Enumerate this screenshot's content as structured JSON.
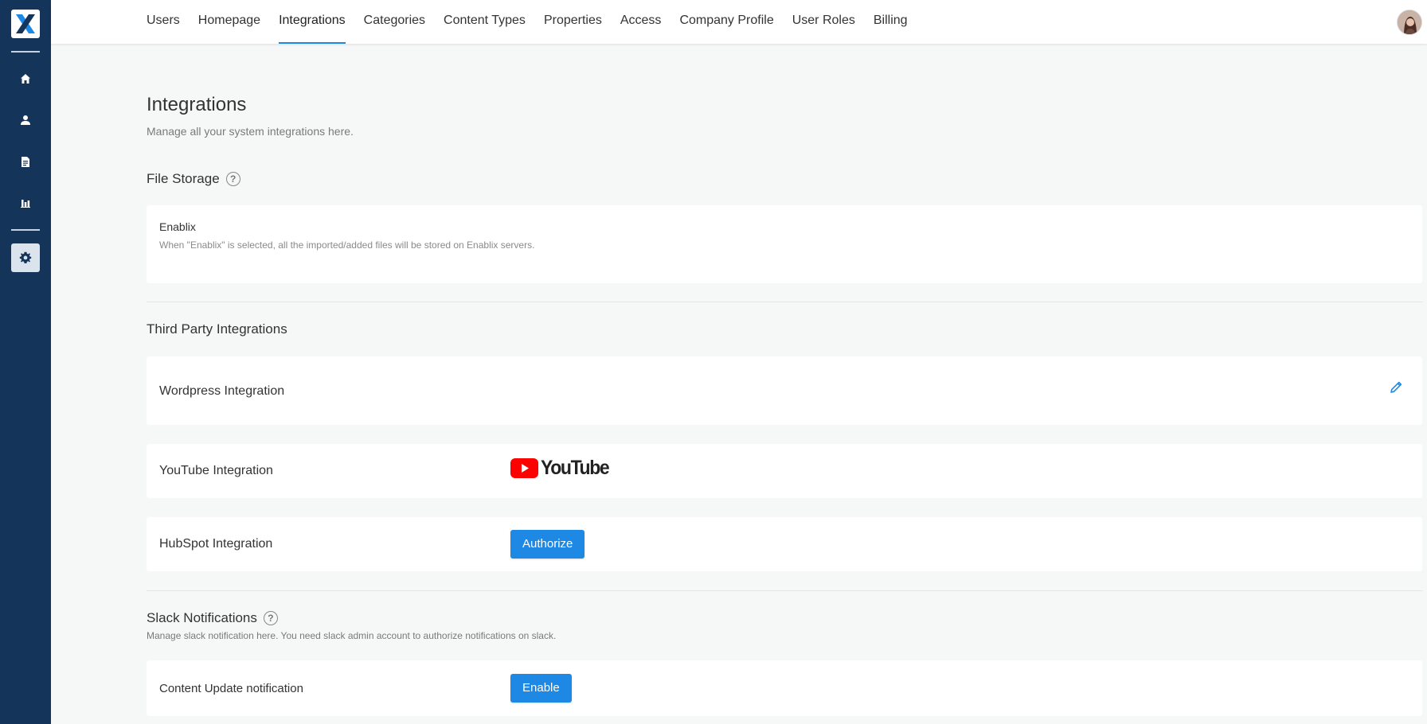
{
  "nav": {
    "tabs": [
      {
        "label": "Users"
      },
      {
        "label": "Homepage"
      },
      {
        "label": "Integrations",
        "active": true
      },
      {
        "label": "Categories"
      },
      {
        "label": "Content Types"
      },
      {
        "label": "Properties"
      },
      {
        "label": "Access"
      },
      {
        "label": "Company Profile"
      },
      {
        "label": "User Roles"
      },
      {
        "label": "Billing"
      }
    ]
  },
  "sidebar": {
    "icons": [
      "home-icon",
      "user-icon",
      "document-icon",
      "bar-chart-icon",
      "gear-icon"
    ],
    "active": "gear-icon"
  },
  "page": {
    "title": "Integrations",
    "subtitle": "Manage all your system integrations here."
  },
  "file_storage": {
    "title": "File Storage",
    "option_name": "Enablix",
    "option_desc": "When \"Enablix\" is selected, all the imported/added files will be stored on Enablix servers."
  },
  "third_party": {
    "title": "Third Party Integrations",
    "wordpress_label": "Wordpress Integration",
    "youtube_label": "YouTube Integration",
    "youtube_logo_text": "YouTube",
    "hubspot_label": "HubSpot Integration",
    "hubspot_button": "Authorize"
  },
  "slack": {
    "title": "Slack Notifications",
    "subtitle": "Manage slack notification here. You need slack admin account to authorize notifications on slack.",
    "content_update_label": "Content Update notification",
    "enable_button": "Enable"
  },
  "colors": {
    "sidebar_bg": "#15345a",
    "accent": "#1e88e5",
    "page_bg": "#f6f7f7",
    "youtube_red": "#ff0000"
  }
}
